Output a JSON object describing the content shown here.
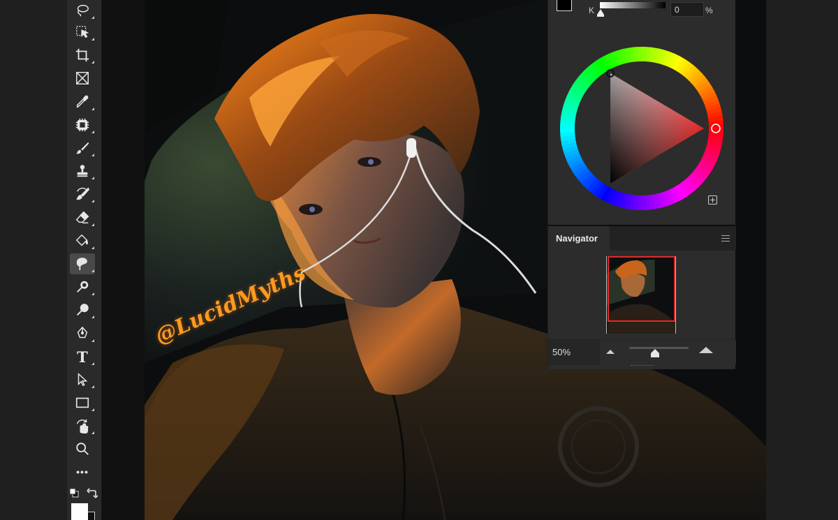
{
  "toolbar": {
    "tools": [
      {
        "name": "lasso-tool",
        "icon": "lasso-icon",
        "active": false
      },
      {
        "name": "object-selection-tool",
        "icon": "object-selection-icon",
        "active": false
      },
      {
        "name": "crop-tool",
        "icon": "crop-icon",
        "active": false
      },
      {
        "name": "frame-tool",
        "icon": "frame-icon",
        "active": false
      },
      {
        "name": "eyedropper-tool",
        "icon": "eyedropper-icon",
        "active": false
      },
      {
        "name": "spot-healing-tool",
        "icon": "spot-healing-icon",
        "active": false
      },
      {
        "name": "brush-tool",
        "icon": "brush-icon",
        "active": false
      },
      {
        "name": "clone-stamp-tool",
        "icon": "stamp-icon",
        "active": false
      },
      {
        "name": "history-brush-tool",
        "icon": "history-brush-icon",
        "active": false
      },
      {
        "name": "eraser-tool",
        "icon": "eraser-icon",
        "active": false
      },
      {
        "name": "paint-bucket-tool",
        "icon": "paint-bucket-icon",
        "active": false
      },
      {
        "name": "smudge-tool",
        "icon": "smudge-icon",
        "active": true
      },
      {
        "name": "dodge-tool",
        "icon": "dodge-icon",
        "active": false
      },
      {
        "name": "burn-tool",
        "icon": "burn-icon",
        "active": false
      },
      {
        "name": "pen-tool",
        "icon": "pen-icon",
        "active": false
      },
      {
        "name": "type-tool",
        "icon": "type-icon",
        "active": false,
        "glyph": "T"
      },
      {
        "name": "path-selection-tool",
        "icon": "path-selection-icon",
        "active": false
      },
      {
        "name": "rectangle-tool",
        "icon": "rectangle-icon",
        "active": false
      },
      {
        "name": "rotate-view-tool",
        "icon": "rotate-view-icon",
        "active": false
      },
      {
        "name": "zoom-tool",
        "icon": "zoom-icon",
        "active": false
      },
      {
        "name": "more-tools",
        "icon": "more-icon",
        "active": false,
        "glyph": "•••"
      }
    ]
  },
  "colors": {
    "canvas_bg": "#111111",
    "panel_bg": "#2c2c2c",
    "accent_orange": "#ff9a1f",
    "navigator_view_border": "#e02a2a",
    "foreground": "#ffffff",
    "background": "#000000"
  },
  "artwork": {
    "watermark": "@LucidMyths"
  },
  "color_panel": {
    "channel_label": "K",
    "channel_value": "0",
    "channel_unit": "%",
    "selected_hue": "red"
  },
  "navigator": {
    "tab_label": "Navigator",
    "zoom_value": "50%",
    "zoom_level": 0.43
  }
}
